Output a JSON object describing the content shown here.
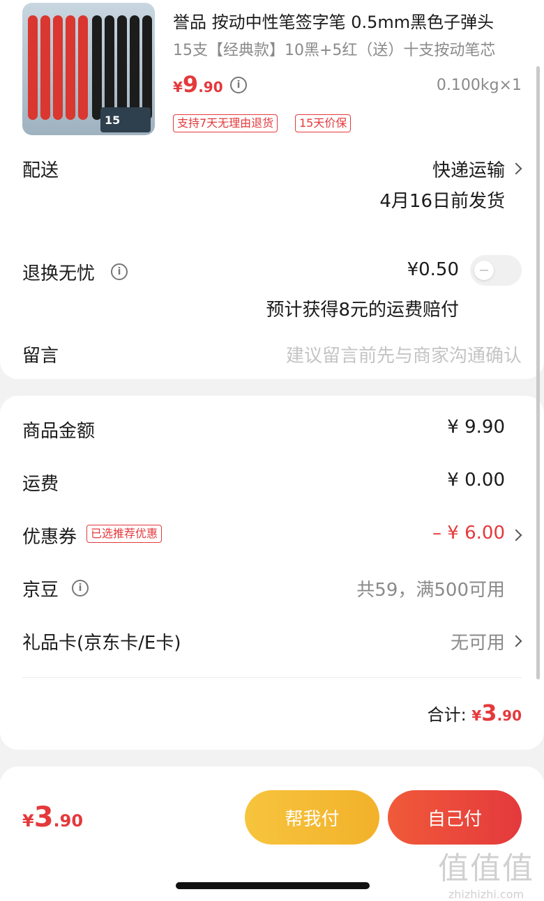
{
  "product": {
    "title": "誉品 按动中性笔签字笔 0.5mm黑色子弹头",
    "spec": "15支【经典款】10黑+5红（送）十支按动笔芯",
    "price_currency": "¥",
    "price_int": "9",
    "price_dec": ".90",
    "weight": "0.100kg×1",
    "tags": [
      "支持7天无理由退货",
      "15天价保"
    ],
    "thumb_box_text": "15"
  },
  "delivery": {
    "label": "配送",
    "method": "快递运输",
    "date": "4月16日前发货"
  },
  "return_worry": {
    "label": "退换无忧",
    "price": "¥0.50",
    "note": "预计获得8元的运费赔付",
    "enabled": false
  },
  "message": {
    "label": "留言",
    "placeholder": "建议留言前先与商家沟通确认"
  },
  "summary": {
    "goods_label": "商品金额",
    "goods_value": "¥ 9.90",
    "shipping_label": "运费",
    "shipping_value": "¥ 0.00",
    "coupon_label": "优惠券",
    "coupon_badge": "已选推荐优惠",
    "coupon_value": "– ¥ 6.00",
    "jingdou_label": "京豆",
    "jingdou_value": "共59，满500可用",
    "giftcard_label": "礼品卡(京东卡/E卡)",
    "giftcard_value": "无可用",
    "total_label": "合计:",
    "total_cur": "¥",
    "total_int": "3",
    "total_dec": ".90"
  },
  "footer": {
    "pay_cur": "¥",
    "pay_int": "3",
    "pay_dec": ".90",
    "help_pay": "帮我付",
    "self_pay": "自己付"
  },
  "watermark": {
    "glyphs": "值值值",
    "url": "zhizhizhi.com"
  },
  "colors": {
    "accent": "#e4393c",
    "help_button": "#f2b12a",
    "self_button": "#e4393c",
    "background": "#f2f2f2"
  }
}
